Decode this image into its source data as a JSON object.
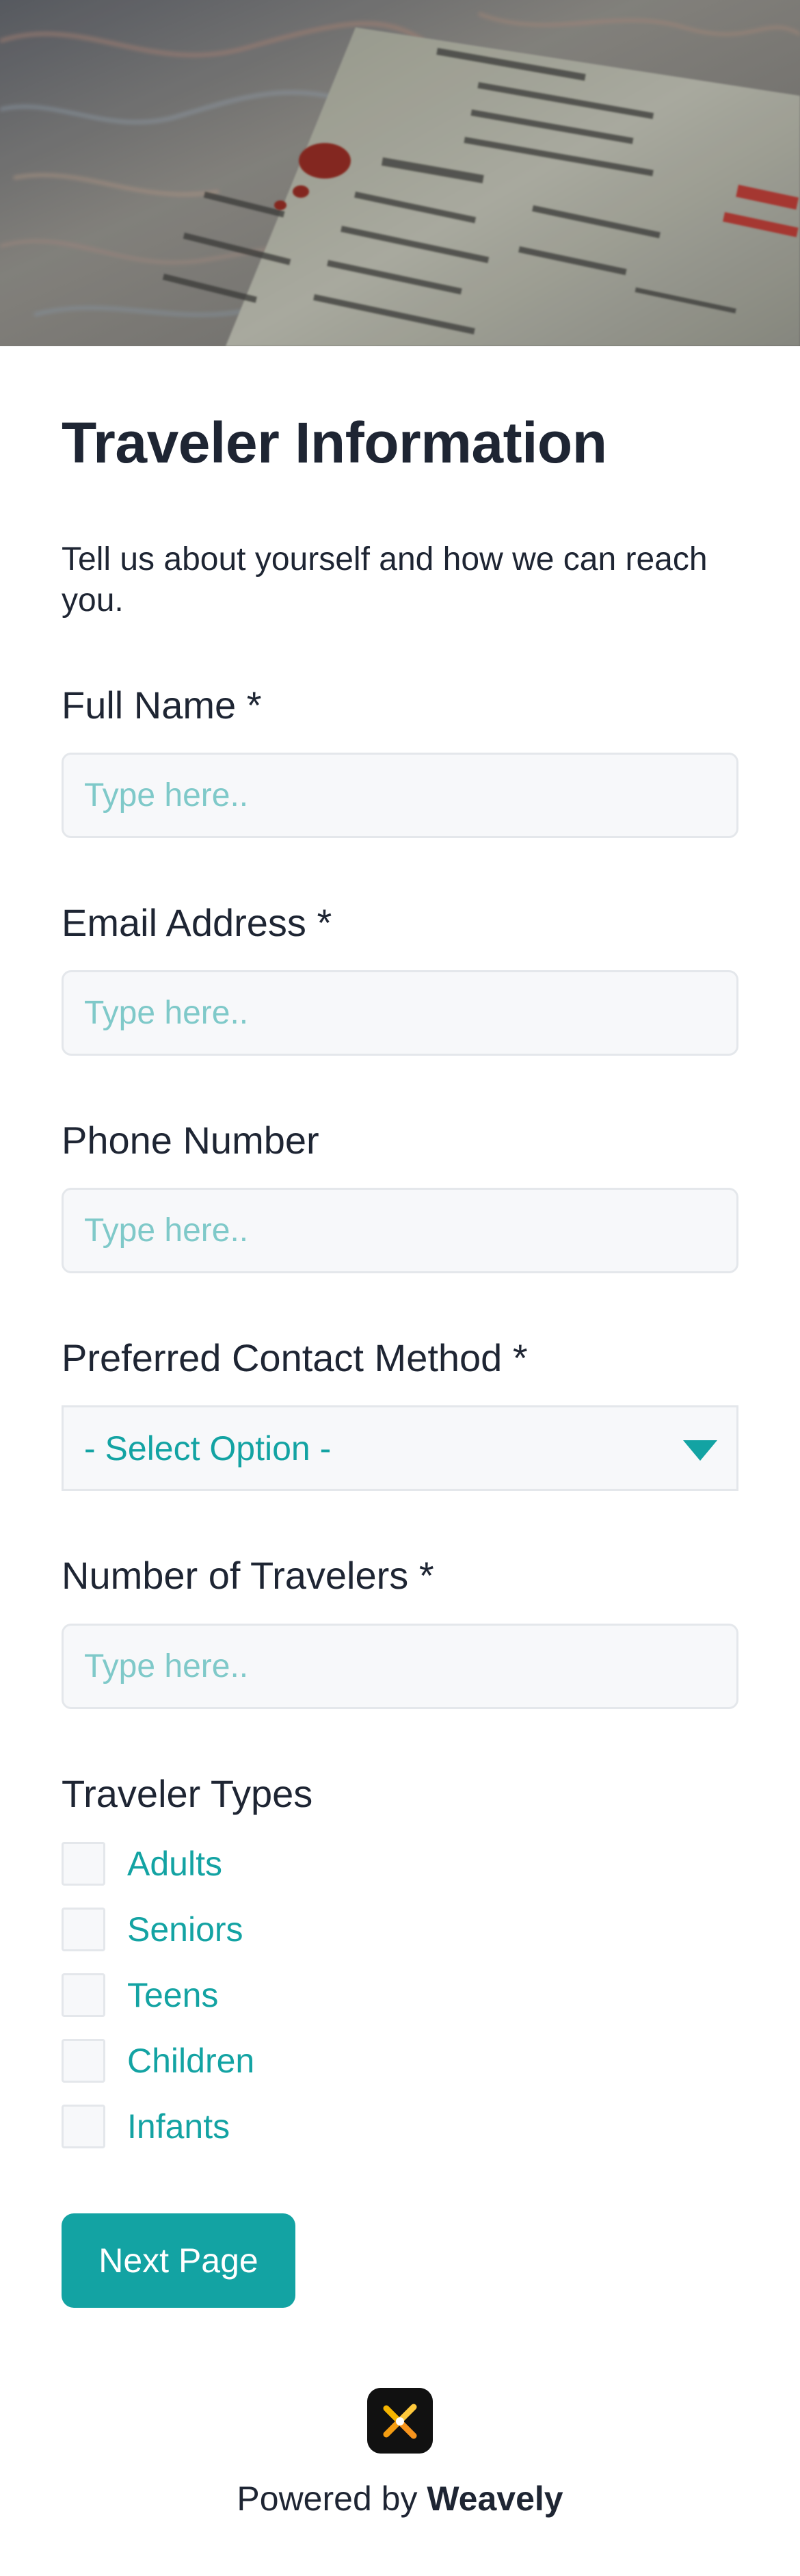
{
  "form": {
    "title": "Traveler Information",
    "subtitle": "Tell us about yourself and how we can reach you.",
    "fields": {
      "full_name": {
        "label": "Full Name *",
        "placeholder": "Type here.."
      },
      "email": {
        "label": "Email Address *",
        "placeholder": "Type here.."
      },
      "phone": {
        "label": "Phone Number",
        "placeholder": "Type here.."
      },
      "contact_method": {
        "label": "Preferred Contact Method *",
        "value": "- Select Option -"
      },
      "num_travelers": {
        "label": "Number of Travelers *",
        "placeholder": "Type here.."
      }
    },
    "traveler_types": {
      "label": "Traveler Types",
      "options": [
        "Adults",
        "Seniors",
        "Teens",
        "Children",
        "Infants"
      ]
    },
    "next_label": "Next Page"
  },
  "footer": {
    "powered_prefix": "Powered by",
    "brand": "Weavely",
    "logo_icon": "weavely-logo-icon"
  },
  "colors": {
    "accent": "#13a3a3",
    "text": "#1e2533",
    "field_bg": "#f7f8fa",
    "field_border": "#e4e7eb"
  }
}
